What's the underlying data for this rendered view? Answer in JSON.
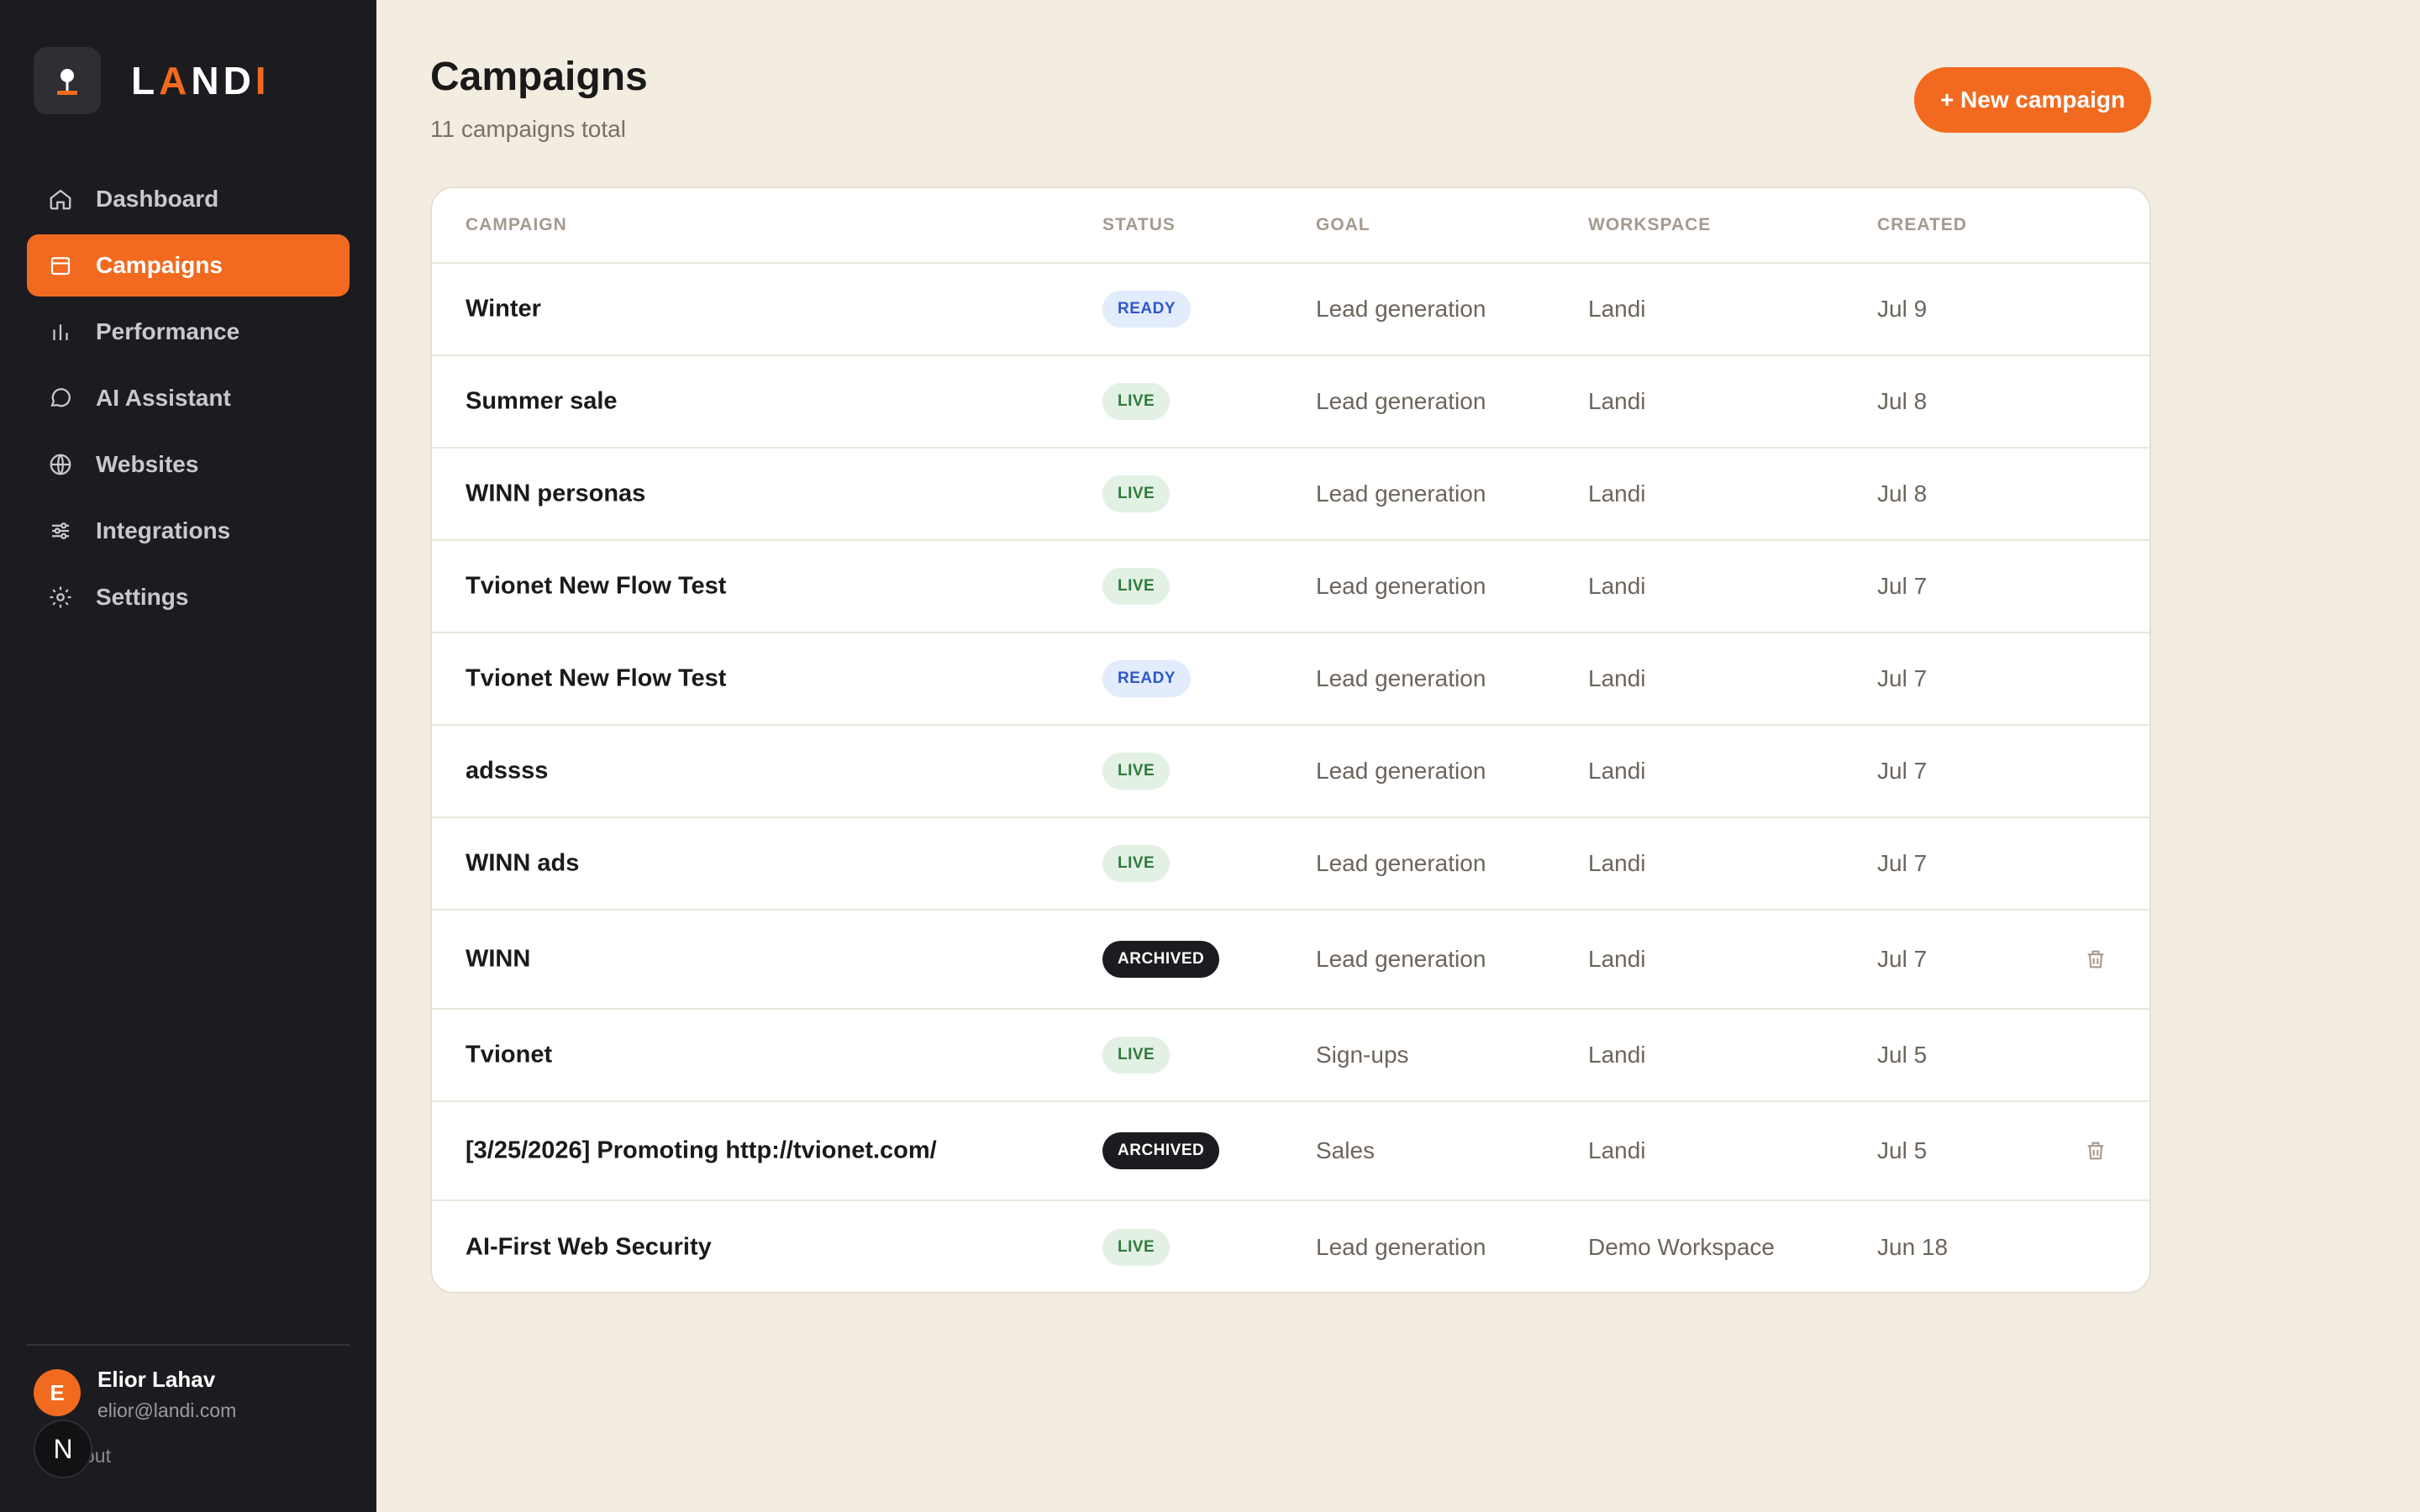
{
  "brand": {
    "name_left": "L",
    "name_accent": "A",
    "name_mid": "ND",
    "name_end": "I"
  },
  "nav": {
    "items": [
      {
        "label": "Dashboard",
        "icon": "home-icon",
        "active": false
      },
      {
        "label": "Campaigns",
        "icon": "calendar-icon",
        "active": true
      },
      {
        "label": "Performance",
        "icon": "bar-chart-icon",
        "active": false
      },
      {
        "label": "AI Assistant",
        "icon": "chat-bubble-icon",
        "active": false
      },
      {
        "label": "Websites",
        "icon": "globe-icon",
        "active": false
      },
      {
        "label": "Integrations",
        "icon": "sliders-icon",
        "active": false
      },
      {
        "label": "Settings",
        "icon": "gear-icon",
        "active": false
      }
    ]
  },
  "user": {
    "initial": "E",
    "name": "Elior Lahav",
    "email": "elior@landi.com",
    "logout_fragment": "out",
    "badge_letter": "N"
  },
  "header": {
    "title": "Campaigns",
    "subtitle": "11 campaigns total",
    "new_button": "+ New campaign"
  },
  "table": {
    "columns": {
      "campaign": "CAMPAIGN",
      "status": "STATUS",
      "goal": "GOAL",
      "workspace": "WORKSPACE",
      "created": "CREATED"
    },
    "rows": [
      {
        "name": "Winter",
        "status": "READY",
        "status_type": "ready",
        "goal": "Lead generation",
        "workspace": "Landi",
        "created": "Jul 9",
        "trash": false
      },
      {
        "name": "Summer sale",
        "status": "LIVE",
        "status_type": "live",
        "goal": "Lead generation",
        "workspace": "Landi",
        "created": "Jul 8",
        "trash": false
      },
      {
        "name": "WINN personas",
        "status": "LIVE",
        "status_type": "live",
        "goal": "Lead generation",
        "workspace": "Landi",
        "created": "Jul 8",
        "trash": false
      },
      {
        "name": "Tvionet New Flow Test",
        "status": "LIVE",
        "status_type": "live",
        "goal": "Lead generation",
        "workspace": "Landi",
        "created": "Jul 7",
        "trash": false
      },
      {
        "name": "Tvionet New Flow Test",
        "status": "READY",
        "status_type": "ready",
        "goal": "Lead generation",
        "workspace": "Landi",
        "created": "Jul 7",
        "trash": false
      },
      {
        "name": "adssss",
        "status": "LIVE",
        "status_type": "live",
        "goal": "Lead generation",
        "workspace": "Landi",
        "created": "Jul 7",
        "trash": false
      },
      {
        "name": "WINN ads",
        "status": "LIVE",
        "status_type": "live",
        "goal": "Lead generation",
        "workspace": "Landi",
        "created": "Jul 7",
        "trash": false
      },
      {
        "name": "WINN",
        "status": "ARCHIVED",
        "status_type": "archived",
        "goal": "Lead generation",
        "workspace": "Landi",
        "created": "Jul 7",
        "trash": true
      },
      {
        "name": "Tvionet",
        "status": "LIVE",
        "status_type": "live",
        "goal": "Sign-ups",
        "workspace": "Landi",
        "created": "Jul 5",
        "trash": false
      },
      {
        "name": "[3/25/2026] Promoting http://tvionet.com/",
        "status": "ARCHIVED",
        "status_type": "archived",
        "goal": "Sales",
        "workspace": "Landi",
        "created": "Jul 5",
        "trash": true
      },
      {
        "name": "AI-First Web Security",
        "status": "LIVE",
        "status_type": "live",
        "goal": "Lead generation",
        "workspace": "Demo Workspace",
        "created": "Jun 18",
        "trash": false
      }
    ]
  },
  "colors": {
    "accent": "#f26a1f",
    "sidebar_bg": "#1c1c20",
    "page_bg": "#f3ece1"
  }
}
